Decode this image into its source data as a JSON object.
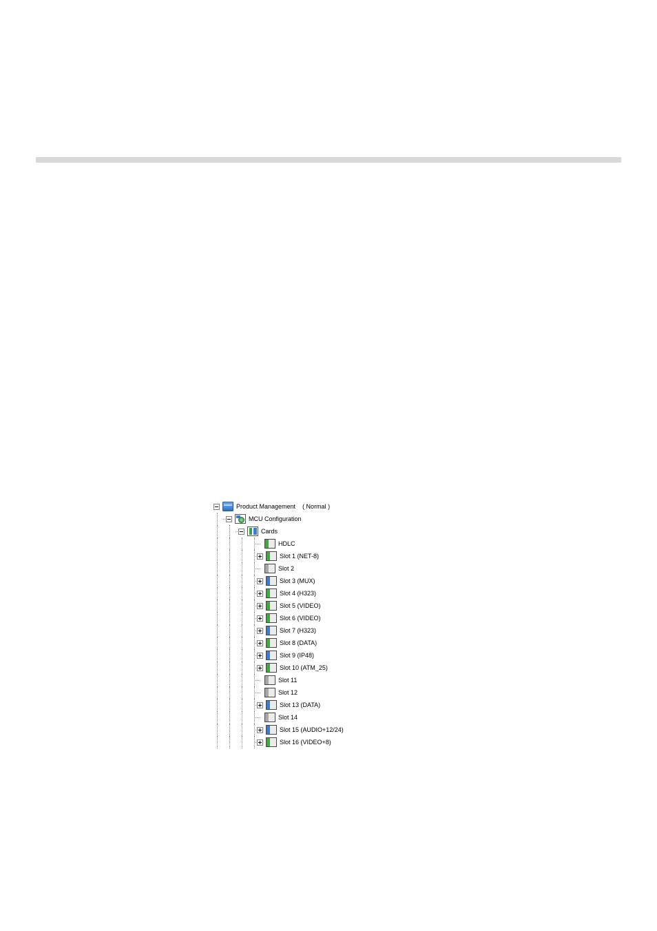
{
  "root": {
    "label": "Product Management",
    "status": "( Normal )"
  },
  "mcu": {
    "label": "MCU Configuration"
  },
  "cards": {
    "label": "Cards"
  },
  "slots": [
    {
      "label": "HDLC",
      "expander": "none",
      "state": "green"
    },
    {
      "label": "Slot 1 (NET-8)",
      "expander": "plus",
      "state": "green"
    },
    {
      "label": "Slot 2",
      "expander": "none",
      "state": "gray"
    },
    {
      "label": "Slot 3 (MUX)",
      "expander": "plus",
      "state": "blue"
    },
    {
      "label": "Slot 4 (H323)",
      "expander": "plus",
      "state": "green"
    },
    {
      "label": "Slot 5 (VIDEO)",
      "expander": "plus",
      "state": "green"
    },
    {
      "label": "Slot 6 (VIDEO)",
      "expander": "plus",
      "state": "green"
    },
    {
      "label": "Slot 7 (H323)",
      "expander": "plus",
      "state": "blue"
    },
    {
      "label": "Slot 8 (DATA)",
      "expander": "plus",
      "state": "green"
    },
    {
      "label": "Slot 9 (IP48)",
      "expander": "plus",
      "state": "blue"
    },
    {
      "label": "Slot 10 (ATM_25)",
      "expander": "plus",
      "state": "green"
    },
    {
      "label": "Slot 11",
      "expander": "none",
      "state": "gray"
    },
    {
      "label": "Slot 12",
      "expander": "none",
      "state": "gray"
    },
    {
      "label": "Slot 13 (DATA)",
      "expander": "plus",
      "state": "blue"
    },
    {
      "label": "Slot 14",
      "expander": "none",
      "state": "gray"
    },
    {
      "label": "Slot 15 (AUDIO+12/24)",
      "expander": "plus",
      "state": "blue"
    },
    {
      "label": "Slot 16 (VIDEO+8)",
      "expander": "plus",
      "state": "green"
    }
  ]
}
